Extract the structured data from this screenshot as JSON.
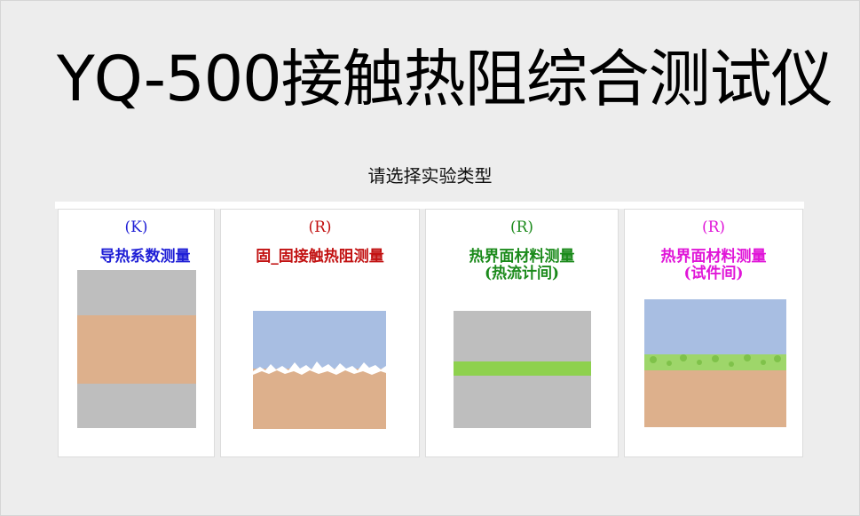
{
  "app": {
    "title": "YQ-500接触热阻综合测试仪"
  },
  "prompt": "请选择实验类型",
  "cards": [
    {
      "kind": "(K)",
      "name": "导热系数测量"
    },
    {
      "kind": "(R)",
      "name": "固_固接触热阻测量"
    },
    {
      "kind": "(R)",
      "name": "热界面材料测量\n(热流计间)"
    },
    {
      "kind": "(R)",
      "name": "热界面材料测量\n(试件间)"
    }
  ],
  "colors": {
    "gray": "#bebebe",
    "tan": "#ddb08c",
    "sky": "#a8bee2",
    "green_layer": "#8ed14e",
    "kind_colors": [
      "#1f1fd6",
      "#c21212",
      "#1b8a1b",
      "#e016d8"
    ]
  }
}
